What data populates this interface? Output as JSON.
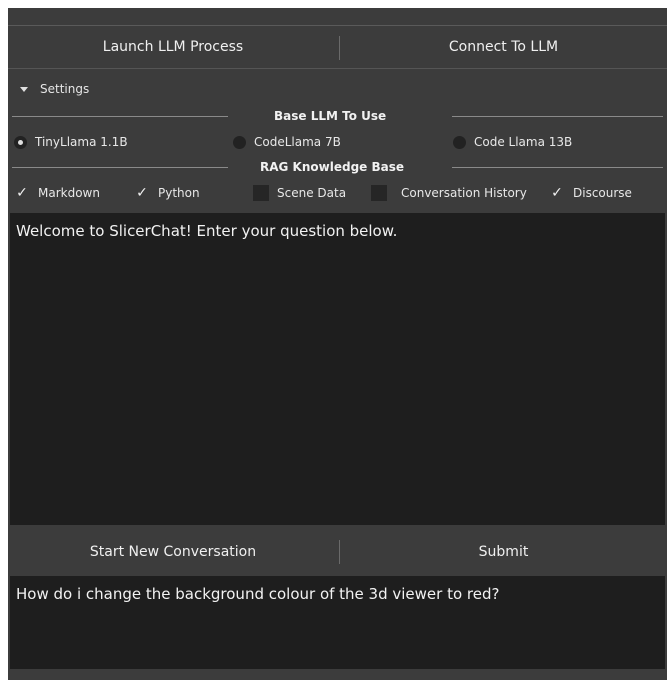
{
  "buttons": {
    "launch": "Launch LLM Process",
    "connect": "Connect To LLM",
    "new_conversation": "Start New Conversation",
    "submit": "Submit"
  },
  "settings": {
    "header": "Settings",
    "llm_group_title": "Base LLM To Use",
    "llm_options": [
      {
        "label": "TinyLlama 1.1B",
        "selected": true
      },
      {
        "label": "CodeLlama 7B",
        "selected": false
      },
      {
        "label": "Code Llama 13B",
        "selected": false
      }
    ],
    "rag_group_title": "RAG Knowledge Base",
    "rag_options": [
      {
        "label": "Markdown",
        "checked": true
      },
      {
        "label": "Python",
        "checked": true
      },
      {
        "label": "Scene Data",
        "checked": false
      },
      {
        "label": "Conversation History",
        "checked": false
      },
      {
        "label": "Discourse",
        "checked": true
      }
    ]
  },
  "chat": {
    "output_text": "Welcome to SlicerChat! Enter your question below.",
    "input_text": "How do i change the background colour of the 3d viewer to red?"
  },
  "icons": {
    "expand": "triangle-down-icon",
    "check": "checkmark-icon"
  }
}
